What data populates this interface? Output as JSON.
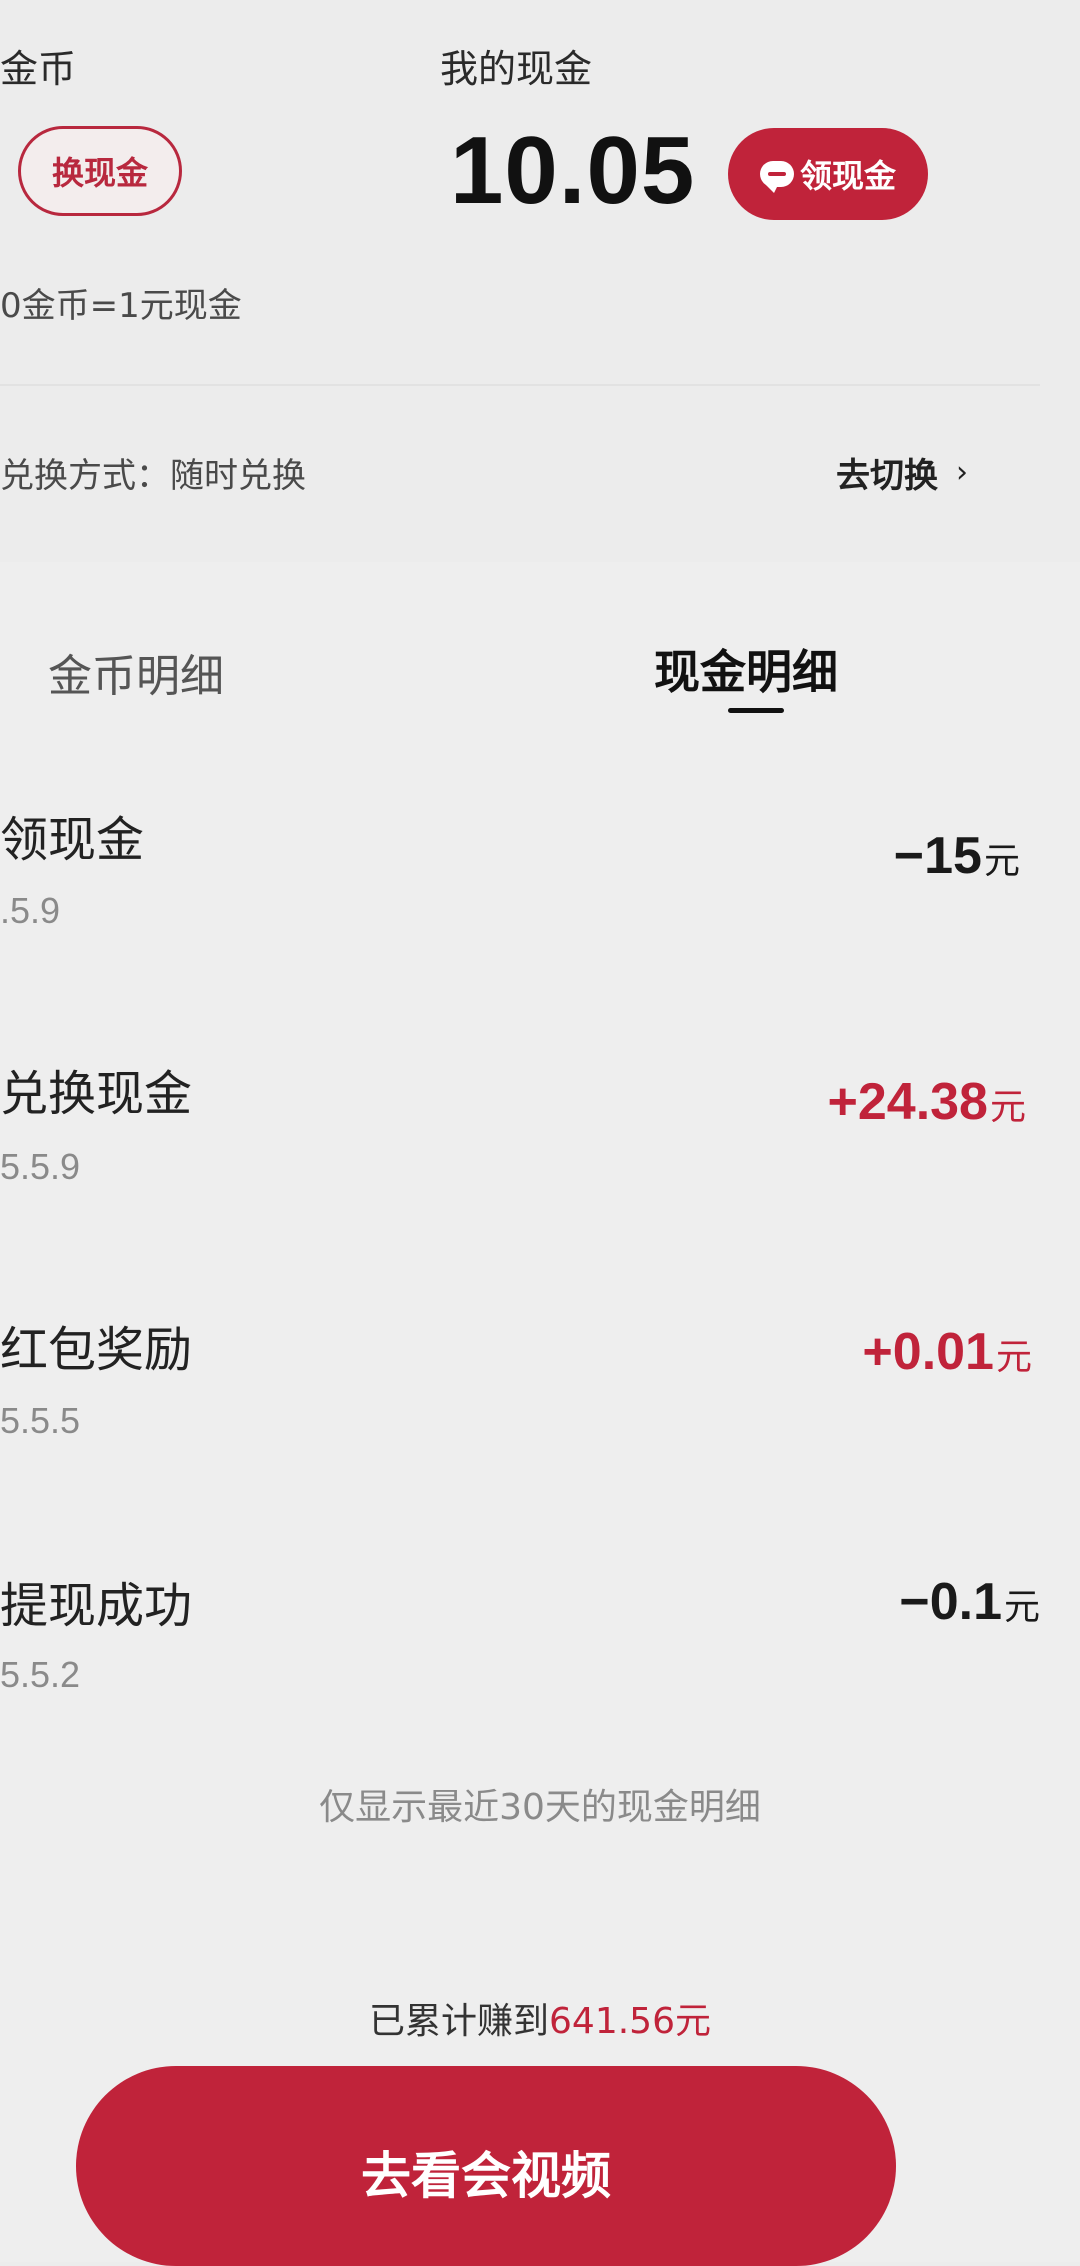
{
  "header": {
    "coin_title": "金币",
    "cash_title": "我的现金",
    "exchange_button": "换现金",
    "cash_amount": "10.05",
    "claim_button": "领现金",
    "rate_text": "0金币=1元现金",
    "mode_text": "兑换方式：随时兑换",
    "switch_link": "去切换"
  },
  "tabs": [
    {
      "label": "金币明细",
      "active": false
    },
    {
      "label": "现金明细",
      "active": true
    }
  ],
  "records": [
    {
      "title": "领现金",
      "date": ".5.9",
      "amount": "−15",
      "unit": "元",
      "sign": "neg"
    },
    {
      "title": "兑换现金",
      "date": "5.5.9",
      "amount": "+24.38",
      "unit": "元",
      "sign": "pos"
    },
    {
      "title": "红包奖励",
      "date": "5.5.5",
      "amount": "+0.01",
      "unit": "元",
      "sign": "pos"
    },
    {
      "title": "提现成功",
      "date": "5.5.2",
      "amount": "−0.1",
      "unit": "元",
      "sign": "neg"
    }
  ],
  "notice": "仅显示最近30天的现金明细",
  "footer": {
    "total_prefix": "已累计赚到",
    "total_amount": "641.56元",
    "watch_button": "去看会视频"
  },
  "colors": {
    "accent": "#c0233a",
    "background": "#ececec"
  },
  "icons": {
    "claim_icon": "chat-bubble-icon",
    "switch_icon": "chevron-right-icon"
  }
}
